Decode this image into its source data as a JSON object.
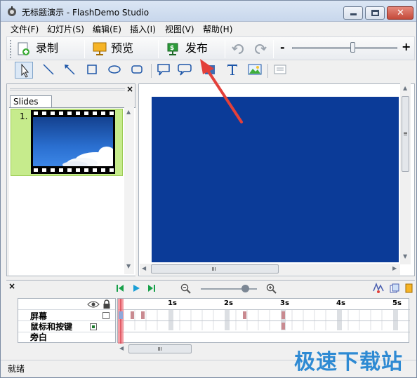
{
  "window": {
    "title": "无标题演示 - FlashDemo Studio",
    "min_icon": "minimize-icon",
    "max_icon": "maximize-icon",
    "close_glyph": "✕"
  },
  "menu": [
    "文件(F)",
    "幻灯片(S)",
    "编辑(E)",
    "插入(I)",
    "视图(V)",
    "帮助(H)"
  ],
  "toolbar": {
    "record_label": "录制",
    "preview_label": "预览",
    "publish_label": "发布",
    "zoom_minus": "-",
    "zoom_plus": "+",
    "zoom_level": 0.57
  },
  "slides": {
    "tab_label": "Slides",
    "items": [
      {
        "number": "1."
      }
    ]
  },
  "timeline": {
    "layers": [
      "屏幕",
      "鼠标和按键",
      "旁白"
    ],
    "ruler": [
      "1s",
      "2s",
      "3s",
      "4s",
      "5s"
    ]
  },
  "status": {
    "text": "就绪"
  },
  "watermark": "极速下载站",
  "colors": {
    "stage": "#0b3b98",
    "slide_highlight": "#c6eb8c",
    "arrow": "#e3403a",
    "playhead": "#f07c86"
  }
}
